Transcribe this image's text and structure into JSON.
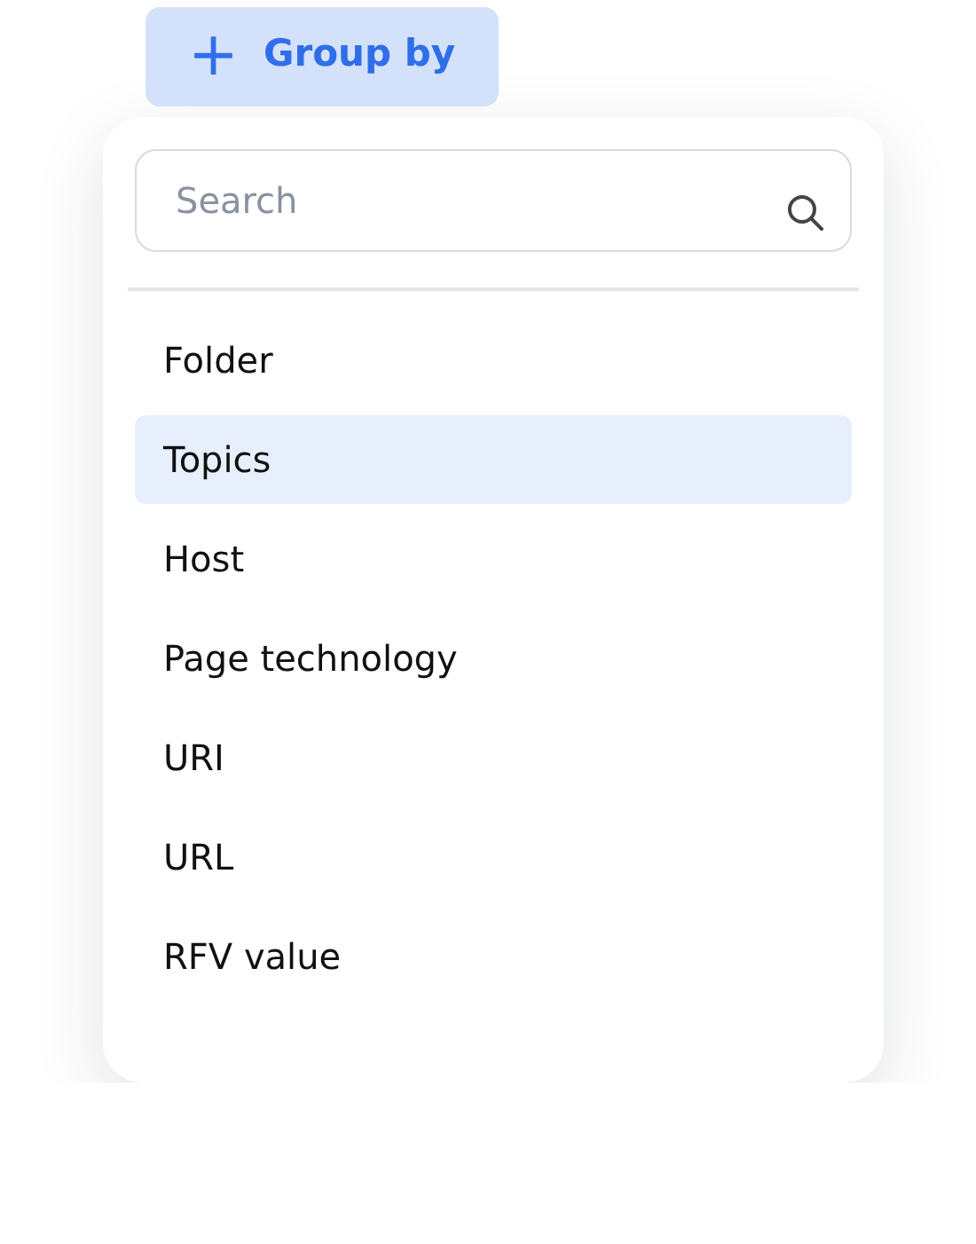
{
  "group_button": {
    "icon": "+",
    "label": "Group by"
  },
  "search": {
    "placeholder": "Search"
  },
  "items": [
    {
      "label": "Folder",
      "selected": false
    },
    {
      "label": "Topics",
      "selected": true
    },
    {
      "label": "Host",
      "selected": false
    },
    {
      "label": "Page technology",
      "selected": false
    },
    {
      "label": "URI",
      "selected": false
    },
    {
      "label": "URL",
      "selected": false
    },
    {
      "label": "RFV value",
      "selected": false
    }
  ]
}
